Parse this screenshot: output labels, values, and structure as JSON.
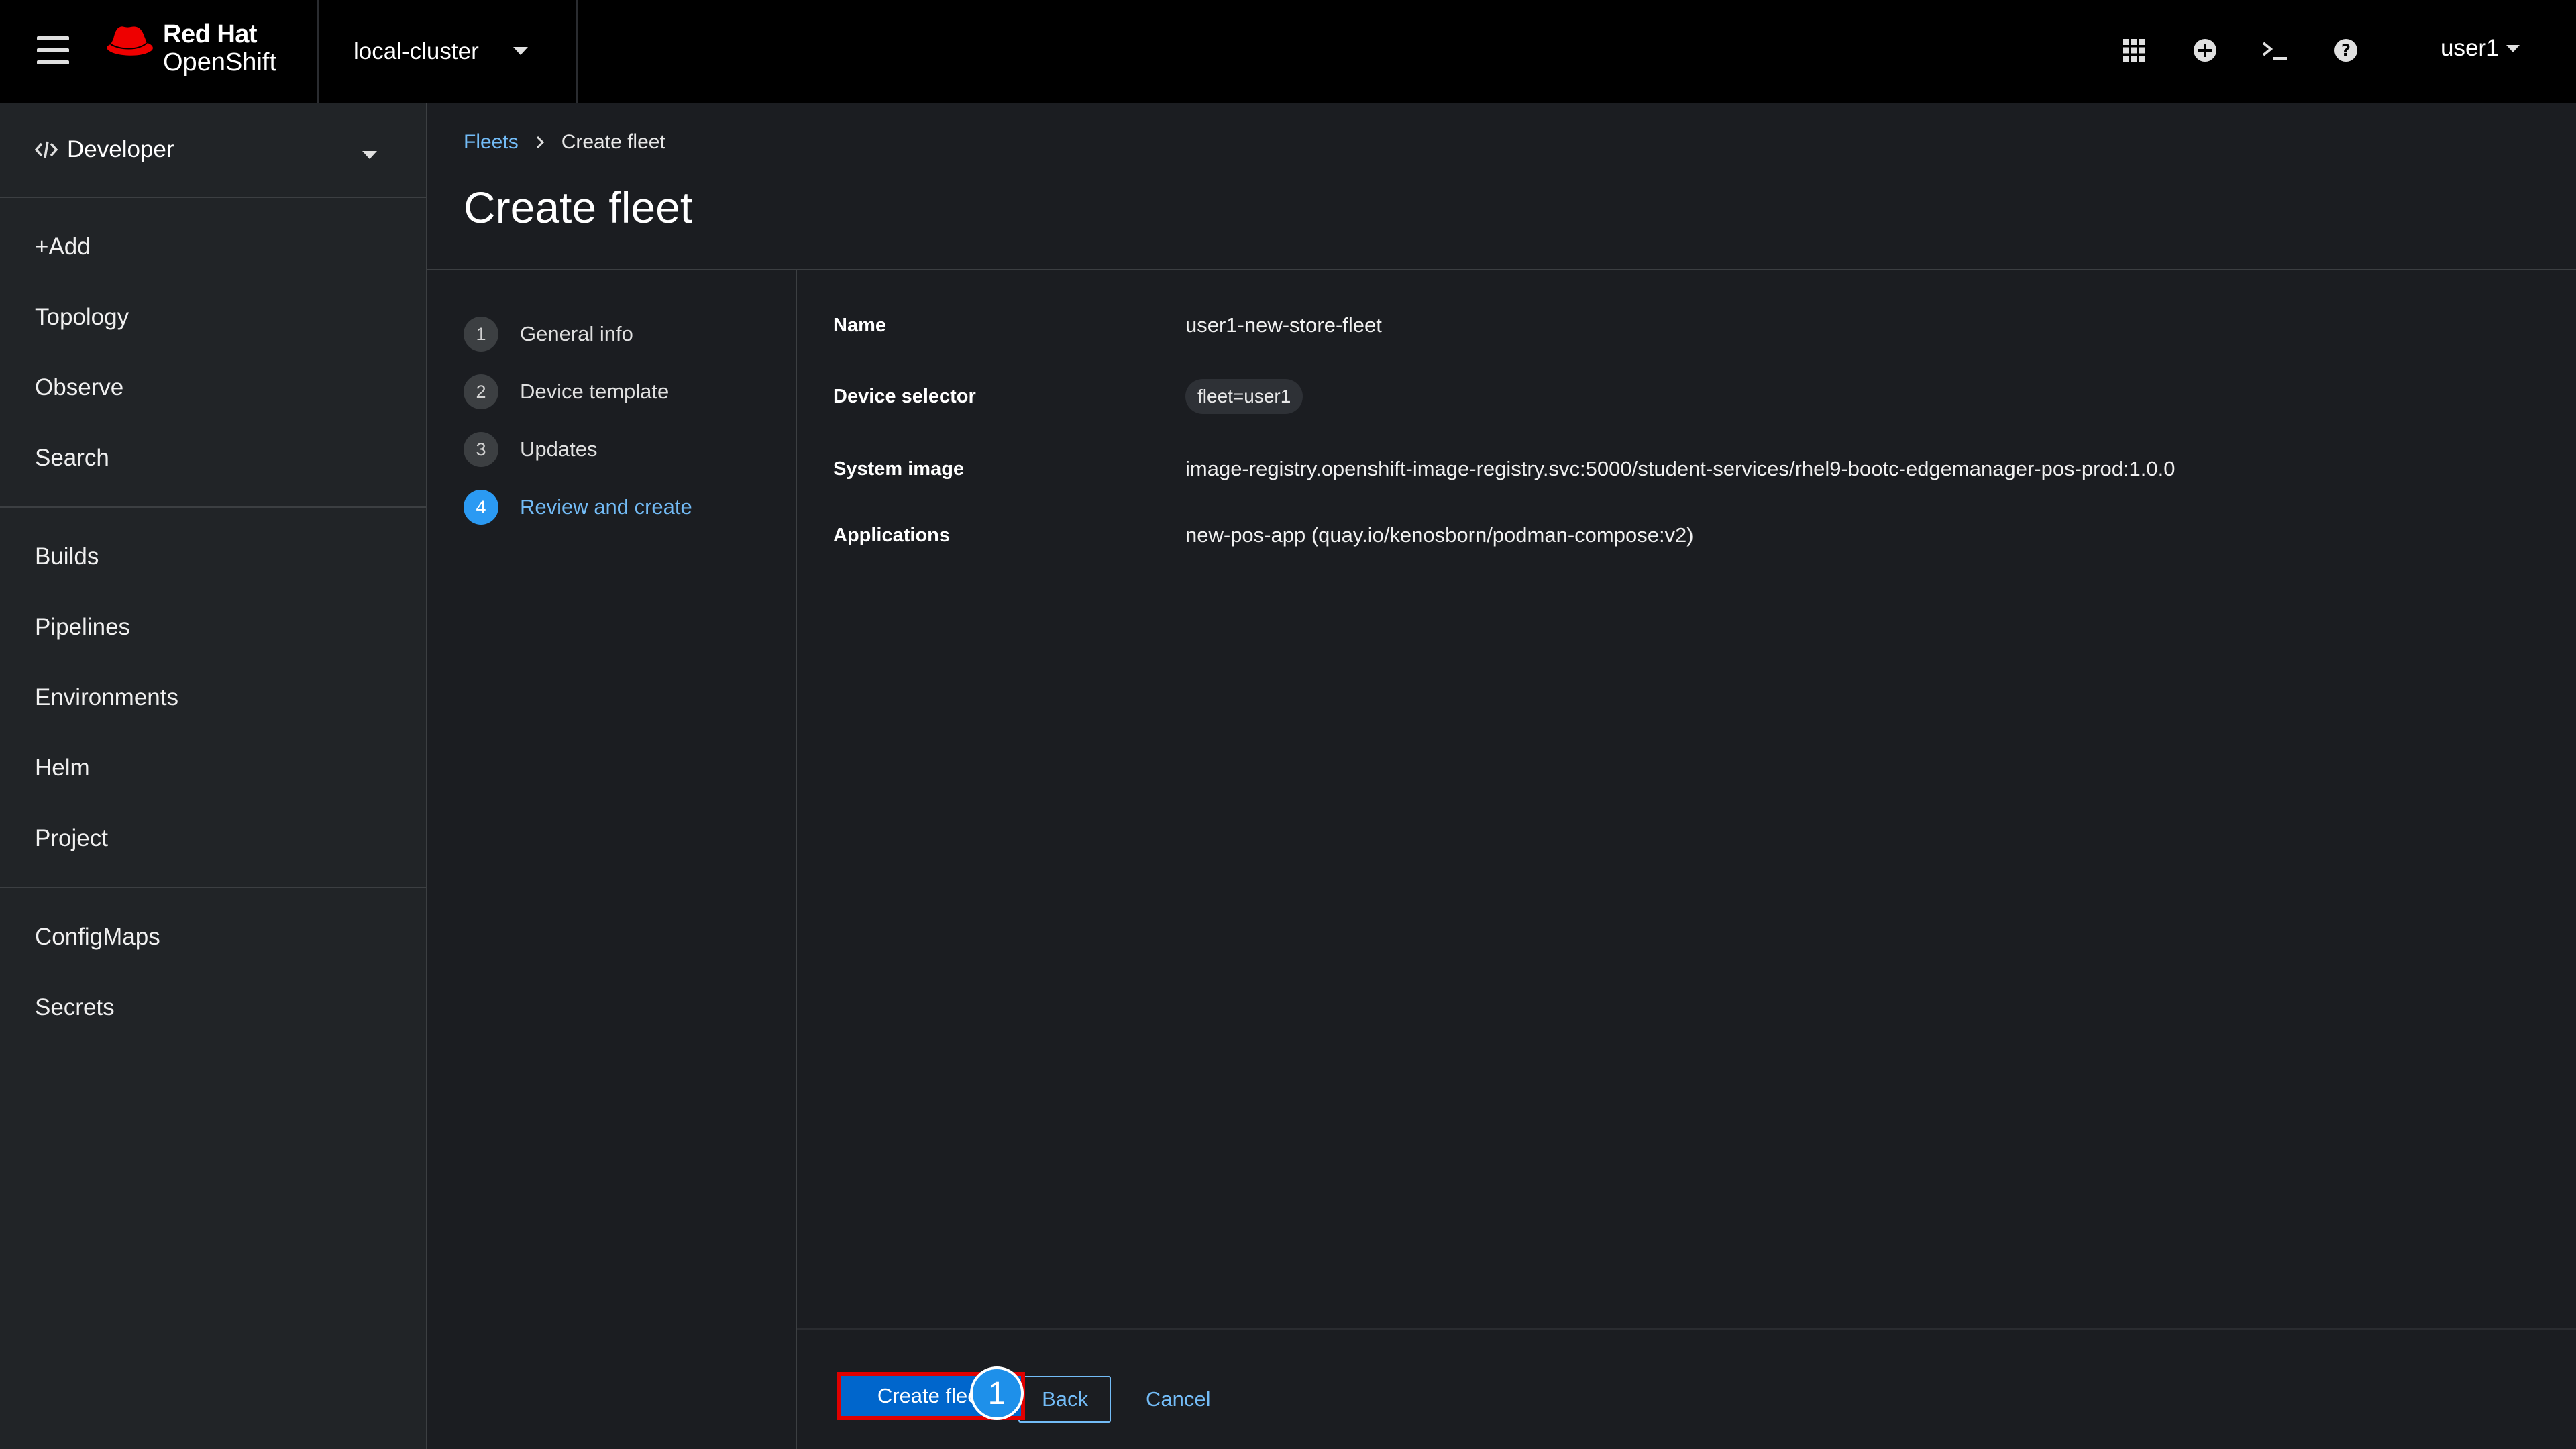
{
  "masthead": {
    "brand_line1": "Red Hat",
    "brand_line2": "OpenShift",
    "cluster": "local-cluster",
    "user": "user1"
  },
  "sidebar": {
    "perspective": "Developer",
    "groups": [
      [
        "+Add",
        "Topology",
        "Observe",
        "Search"
      ],
      [
        "Builds",
        "Pipelines",
        "Environments",
        "Helm",
        "Project"
      ],
      [
        "ConfigMaps",
        "Secrets"
      ]
    ]
  },
  "breadcrumb": {
    "parent": "Fleets",
    "current": "Create fleet"
  },
  "page": {
    "title": "Create fleet"
  },
  "wizard": {
    "steps": [
      {
        "num": "1",
        "label": "General info"
      },
      {
        "num": "2",
        "label": "Device template"
      },
      {
        "num": "3",
        "label": "Updates"
      },
      {
        "num": "4",
        "label": "Review and create"
      }
    ],
    "current_step": "4",
    "review": {
      "name_label": "Name",
      "name_value": "user1-new-store-fleet",
      "selector_label": "Device selector",
      "selector_value": "fleet=user1",
      "image_label": "System image",
      "image_value": "image-registry.openshift-image-registry.svc:5000/student-services/rhel9-bootc-edgemanager-pos-prod:1.0.0",
      "apps_label": "Applications",
      "apps_value": "new-pos-app (quay.io/kenosborn/podman-compose:v2)"
    },
    "footer": {
      "primary": "Create fleet",
      "back": "Back",
      "cancel": "Cancel",
      "badge": "1"
    }
  },
  "colors": {
    "link": "#73bcf7",
    "primary": "#0066cc",
    "highlight": "#e00000",
    "brand_red": "#ee0000"
  }
}
